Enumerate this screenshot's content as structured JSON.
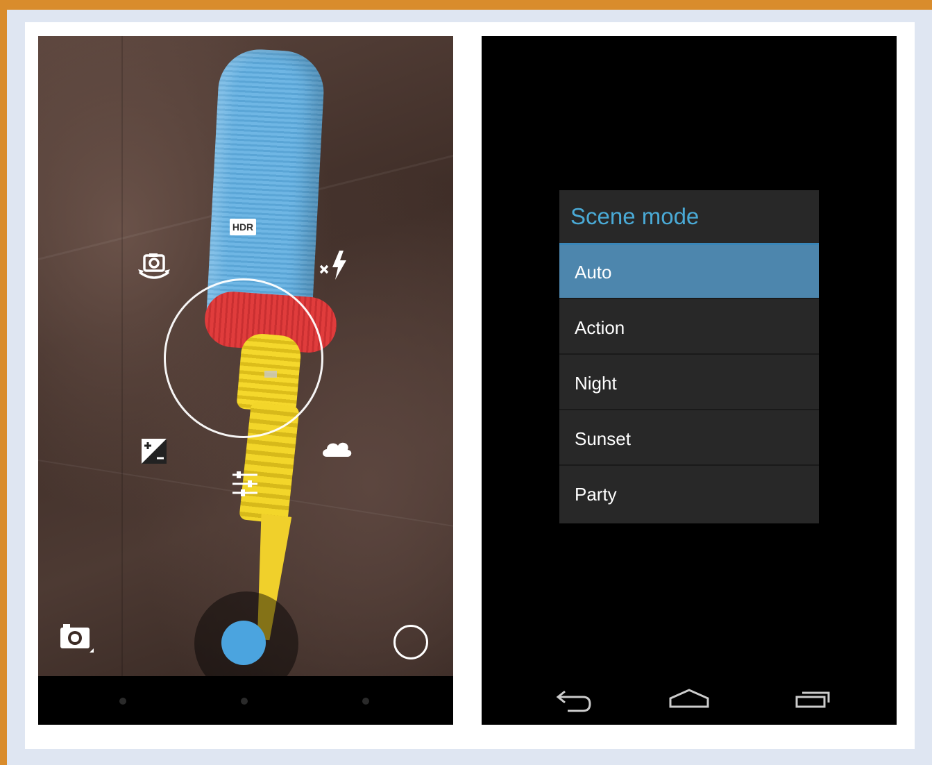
{
  "camera": {
    "hdr_label": "HDR",
    "icons": {
      "switch_camera": "camera-switch-icon",
      "flash": "flash-off-icon",
      "exposure": "exposure-icon",
      "white_balance": "cloudy-icon",
      "settings": "settings-sliders-icon",
      "mode": "camera-mode-icon"
    },
    "shutter_color": "#4ba4df"
  },
  "scene_dialog": {
    "title": "Scene mode",
    "options": [
      "Auto",
      "Action",
      "Night",
      "Sunset",
      "Party"
    ],
    "selected": "Auto",
    "accent_color": "#4aaad6",
    "selected_color": "#4d86ad"
  },
  "nav": {
    "icons": [
      "back-icon",
      "home-icon",
      "recents-icon"
    ]
  }
}
